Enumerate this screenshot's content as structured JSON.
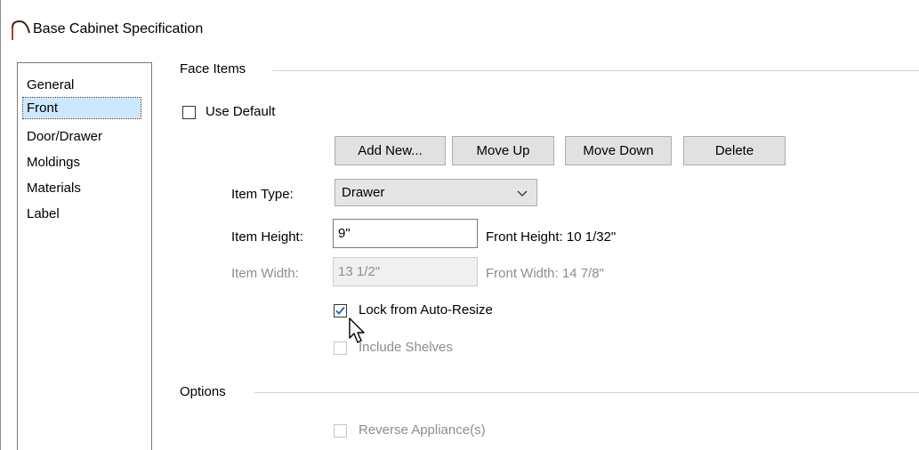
{
  "window": {
    "title": "Base Cabinet Specification"
  },
  "sidebar": {
    "items": [
      {
        "label": "General"
      },
      {
        "label": "Front",
        "selected": true
      },
      {
        "label": "Door/Drawer"
      },
      {
        "label": "Moldings"
      },
      {
        "label": "Materials"
      },
      {
        "label": "Label"
      }
    ]
  },
  "face_items": {
    "group_title": "Face Items",
    "use_default": {
      "label": "Use Default",
      "checked": false
    },
    "buttons": {
      "add_new": "Add New...",
      "move_up": "Move Up",
      "move_down": "Move Down",
      "delete": "Delete"
    },
    "item_type": {
      "label": "Item Type:",
      "value": "Drawer"
    },
    "item_height": {
      "label": "Item Height:",
      "value": "9\""
    },
    "front_height": "Front Height:  10 1/32\"",
    "item_width": {
      "label": "Item Width:",
      "value": "13 1/2\""
    },
    "front_width": "Front Width:  14 7/8\"",
    "lock_auto_resize": {
      "label": "Lock from Auto-Resize",
      "checked": true
    },
    "include_shelves": {
      "label": "Include Shelves",
      "checked": false
    }
  },
  "options": {
    "group_title": "Options",
    "reverse_appliances": {
      "label": "Reverse Appliance(s)",
      "checked": false
    }
  }
}
